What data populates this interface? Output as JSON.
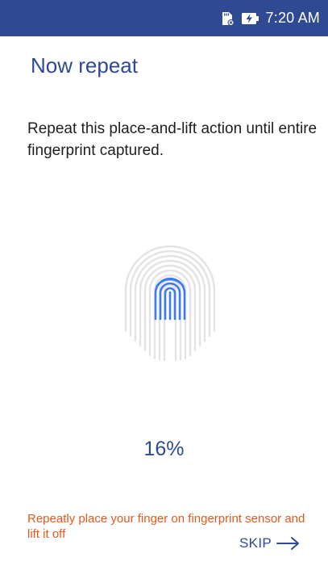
{
  "status_bar": {
    "time": "7:20 AM",
    "icons": [
      "sd-card-icon",
      "battery-charging-icon"
    ],
    "background": "#2f4a93"
  },
  "page": {
    "title": "Now repeat",
    "instructions": "Repeat this place-and-lift action until entire fingerprint captured.",
    "progress_percent": "16%",
    "progress_value": 0.16,
    "hint": "Repeatly place your finger on fingerprint sensor and lift it off",
    "skip_label": "SKIP"
  },
  "colors": {
    "accent": "#2f4a93",
    "fingerprint_active": "#3d7bf0",
    "fingerprint_inactive": "#e3e3e3",
    "hint": "#e05a1e"
  }
}
